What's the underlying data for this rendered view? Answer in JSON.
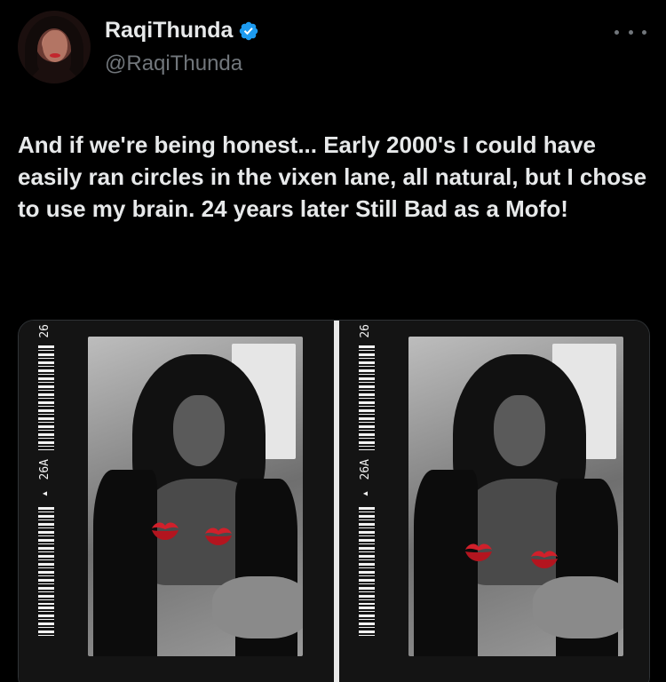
{
  "tweet": {
    "display_name": "RaqiThunda",
    "handle": "@RaqiThunda",
    "verified": true,
    "text": "And if we're being honest... Early 2000's I could have easily ran circles in the vixen lane, all natural, but I chose to use my brain. 24 years later Still Bad as a Mofo!"
  },
  "media": {
    "frames": [
      {
        "edge_label_top": "26",
        "edge_label_mid": "▸ 26A"
      },
      {
        "edge_label_top": "26",
        "edge_label_mid": "▸ 26A"
      }
    ]
  },
  "colors": {
    "background": "#000000",
    "text": "#e7e9ea",
    "secondary": "#71767b",
    "verified": "#1d9bf0",
    "kiss": "#d0202b"
  },
  "icons": [
    "verified-badge-icon",
    "more-options-icon",
    "kiss-emoji-icon"
  ]
}
